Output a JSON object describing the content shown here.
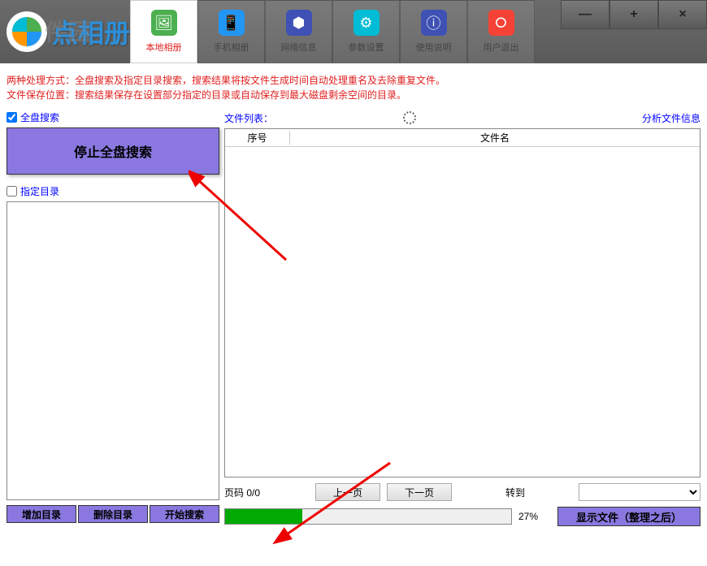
{
  "app": {
    "title": "点相册",
    "ghost": "件园"
  },
  "toolbar": [
    {
      "label": "本地相册",
      "active": true
    },
    {
      "label": "手机相册",
      "active": false
    },
    {
      "label": "网络信息",
      "active": false
    },
    {
      "label": "参数设置",
      "active": false
    },
    {
      "label": "使用说明",
      "active": false
    },
    {
      "label": "用户退出",
      "active": false
    }
  ],
  "win": {
    "min": "—",
    "max": "+",
    "close": "×"
  },
  "info": {
    "line1": "两种处理方式：全盘搜索及指定目录搜索，搜索结果将按文件生成时间自动处理重名及去除重复文件。",
    "line2": "文件保存位置：搜索结果保存在设置部分指定的目录或自动保存到最大磁盘剩余空间的目录。"
  },
  "controls": {
    "fullSearch": "全盘搜索",
    "stopSearch": "停止全盘搜索",
    "specifyDir": "指定目录",
    "addDir": "增加目录",
    "delDir": "删除目录",
    "startSearch": "开始搜索"
  },
  "fileList": {
    "label": "文件列表：",
    "analyze": "分析文件信息",
    "colNum": "序号",
    "colName": "文件名"
  },
  "pager": {
    "pageLabel": "页码 0/0",
    "prev": "上一页",
    "next": "下一页",
    "goto": "转到"
  },
  "progress": {
    "percent": 27,
    "showFiles": "显示文件（整理之后）"
  }
}
